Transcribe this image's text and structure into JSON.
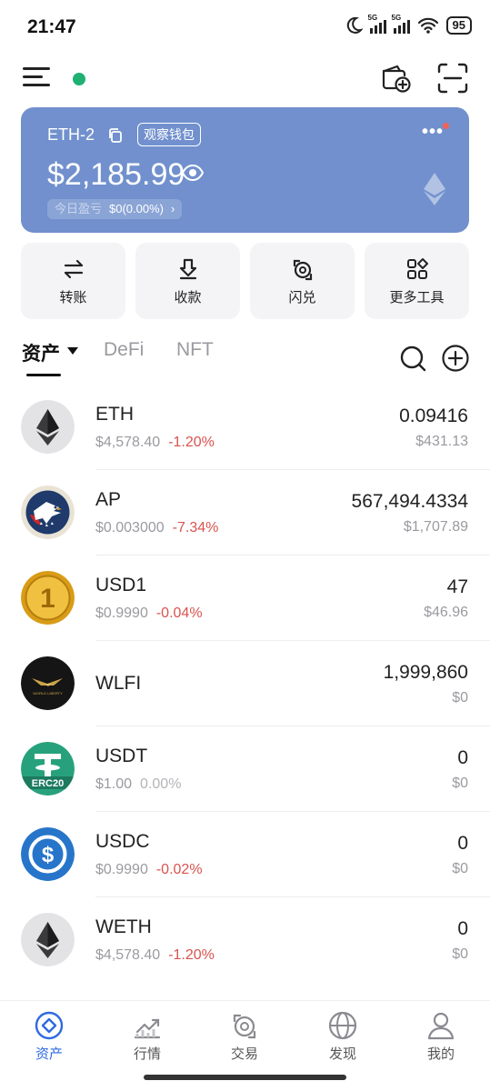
{
  "status_bar": {
    "time": "21:47",
    "battery": "95",
    "network_a": "5G",
    "network_b": "5G"
  },
  "wallet": {
    "name": "ETH-2",
    "watch_badge": "观察钱包",
    "balance": "$2,185.99",
    "pnl_label": "今日盈亏",
    "pnl_value": "$0(0.00%)",
    "pnl_chevron": "›",
    "more": "•••"
  },
  "actions": [
    {
      "label": "转账",
      "icon": "transfer-icon"
    },
    {
      "label": "收款",
      "icon": "receive-icon"
    },
    {
      "label": "闪兑",
      "icon": "swap-icon"
    },
    {
      "label": "更多工具",
      "icon": "grid-icon"
    }
  ],
  "tabs": {
    "assets": "资产",
    "defi": "DeFi",
    "nft": "NFT"
  },
  "assets": [
    {
      "symbol": "ETH",
      "price": "$4,578.40",
      "change": "-1.20%",
      "amount": "0.09416",
      "value": "$431.13",
      "logo": "eth-logo"
    },
    {
      "symbol": "AP",
      "price": "$0.003000",
      "change": "-7.34%",
      "amount": "567,494.4334",
      "value": "$1,707.89",
      "logo": "eagle-logo"
    },
    {
      "symbol": "USD1",
      "price": "$0.9990",
      "change": "-0.04%",
      "amount": "47",
      "value": "$46.96",
      "logo": "usd1-logo"
    },
    {
      "symbol": "WLFI",
      "price": "",
      "change": "",
      "amount": "1,999,860",
      "value": "$0",
      "logo": "wlfi-logo",
      "logo_text": "WORLD LIBERTY"
    },
    {
      "symbol": "USDT",
      "price": "$1.00",
      "change": "0.00%",
      "amount": "0",
      "value": "$0",
      "logo": "usdt-logo",
      "logo_text": "ERC20"
    },
    {
      "symbol": "USDC",
      "price": "$0.9990",
      "change": "-0.02%",
      "amount": "0",
      "value": "$0",
      "logo": "usdc-logo"
    },
    {
      "symbol": "WETH",
      "price": "$4,578.40",
      "change": "-1.20%",
      "amount": "0",
      "value": "$0",
      "logo": "eth-logo"
    }
  ],
  "bottom_nav": [
    {
      "label": "资产",
      "icon": "assets-icon",
      "active": true
    },
    {
      "label": "行情",
      "icon": "market-icon",
      "active": false
    },
    {
      "label": "交易",
      "icon": "trade-icon",
      "active": false
    },
    {
      "label": "发现",
      "icon": "discover-icon",
      "active": false
    },
    {
      "label": "我的",
      "icon": "profile-icon",
      "active": false
    }
  ],
  "colors": {
    "card": "#7190cd",
    "accent": "#2f6ae0",
    "negative": "#d9534f",
    "online": "#1fb073"
  }
}
